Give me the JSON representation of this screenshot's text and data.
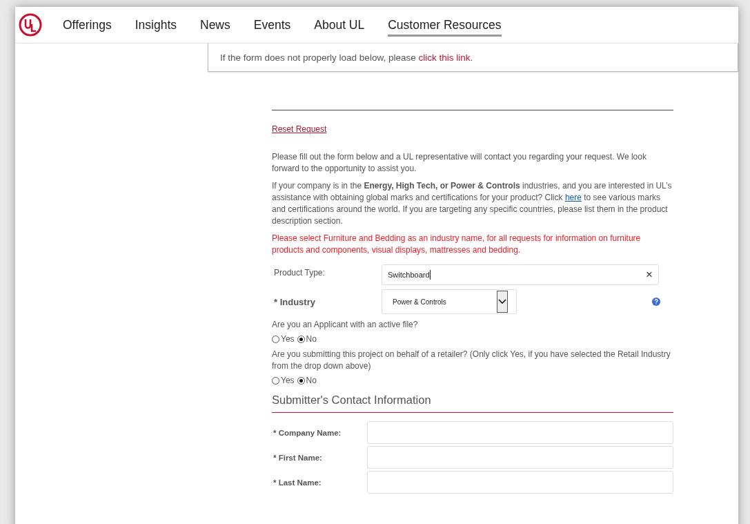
{
  "nav": {
    "items": [
      {
        "label": "Offerings",
        "selected": false
      },
      {
        "label": "Insights",
        "selected": false
      },
      {
        "label": "News",
        "selected": false
      },
      {
        "label": "Events",
        "selected": false
      },
      {
        "label": "About UL",
        "selected": false
      },
      {
        "label": "Customer Resources",
        "selected": true
      }
    ]
  },
  "notice": {
    "before": "If the form does not properly load below, please",
    "link": "click this link",
    "after": "."
  },
  "form": {
    "reset_link": "Reset Request",
    "intro": "Please fill out the form below and a UL representative will contact you regarding your request. We look forward to the opportunity to assist you.",
    "info": {
      "before": "If your company is in the **Energy, High Tech, or Power & Controls** industries, and you are interested in UL’s assistance with obtaining global marks and certifications for your product? Click",
      "link": "here",
      "after": "to see various marks and certifications around the world. If you are targeting any specific countries, please list them in the product description section."
    },
    "warning": "Please select Furniture and Bedding as an industry name, for all requests for information on furniture products and components, visual displays, mattresses and bedding.",
    "product_type": {
      "label": "Product Type:",
      "value": "Switchboard",
      "clear": "×"
    },
    "industry": {
      "label": "* Industry",
      "value": "Power & Controls"
    },
    "questions": [
      {
        "text": "Are you an Applicant with an active file?",
        "options": [
          {
            "label": "Yes",
            "selected": false
          },
          {
            "label": "No",
            "selected": true
          }
        ]
      },
      {
        "text": "Are you submitting this project on behalf of a retailer? (Only click Yes, if you have selected the Retail Industry from the drop down above)",
        "options": [
          {
            "label": "Yes",
            "selected": false
          },
          {
            "label": "No",
            "selected": true
          }
        ]
      }
    ],
    "contact": {
      "heading": "Submitter's Contact Information",
      "fields": [
        {
          "label": "* Company Name:"
        },
        {
          "label": "* First Name:"
        },
        {
          "label": "* Last Name:"
        }
      ]
    }
  }
}
